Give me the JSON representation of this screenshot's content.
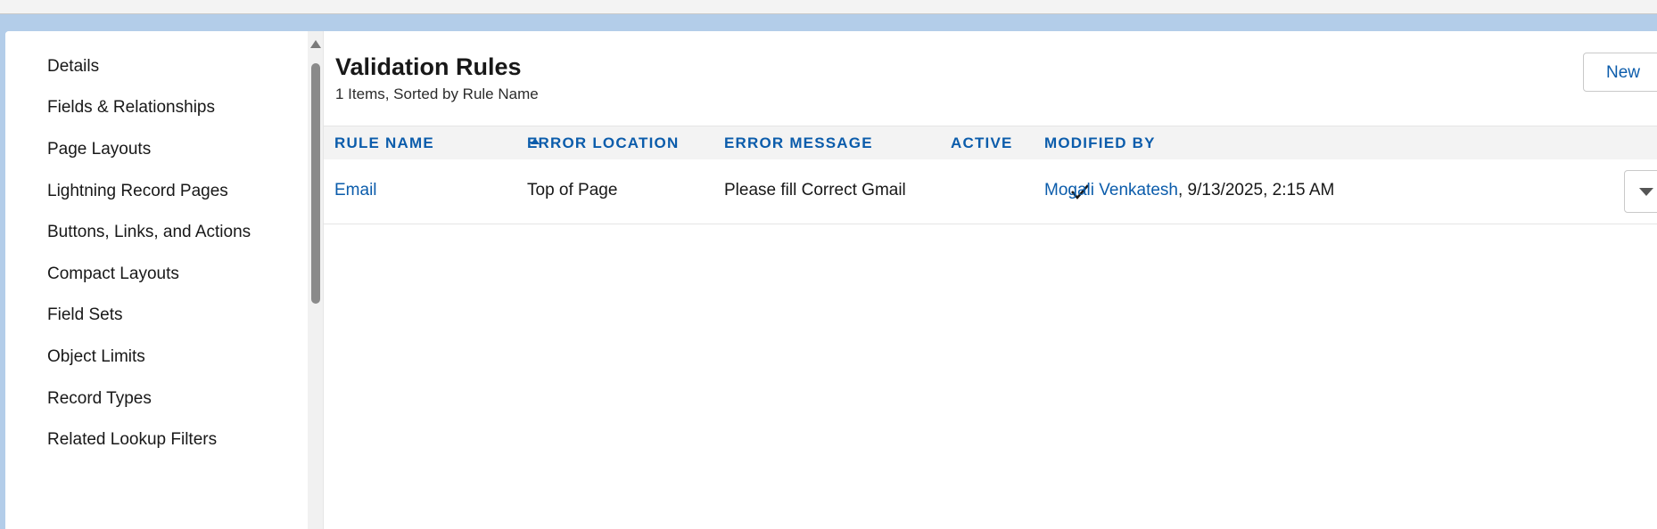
{
  "sidebar": {
    "items": [
      {
        "label": "Details"
      },
      {
        "label": "Fields & Relationships"
      },
      {
        "label": "Page Layouts"
      },
      {
        "label": "Lightning Record Pages"
      },
      {
        "label": "Buttons, Links, and Actions"
      },
      {
        "label": "Compact Layouts"
      },
      {
        "label": "Field Sets"
      },
      {
        "label": "Object Limits"
      },
      {
        "label": "Record Types"
      },
      {
        "label": "Related Lookup Filters"
      }
    ]
  },
  "main": {
    "title": "Validation Rules",
    "subtitle": "1 Items, Sorted by Rule Name",
    "new_button": "New",
    "table": {
      "columns": [
        "RULE NAME",
        "ERROR LOCATION",
        "ERROR MESSAGE",
        "ACTIVE",
        "MODIFIED BY"
      ],
      "sort_column": "RULE NAME",
      "sort_direction": "ascending",
      "rows": [
        {
          "rule_name": "Email",
          "error_location": "Top of Page",
          "error_message": "Please fill Correct Gmail",
          "active": true,
          "modified_by_name": "Mogali Venkatesh",
          "modified_by_date": ", 9/13/2025, 2:15 AM"
        }
      ]
    }
  },
  "icons": {
    "sort": "arrow-up-icon",
    "active": "checkmark-icon",
    "row_menu": "chevron-down-icon"
  },
  "colors": {
    "link": "#0b5cab",
    "background": "#b3cde9"
  }
}
